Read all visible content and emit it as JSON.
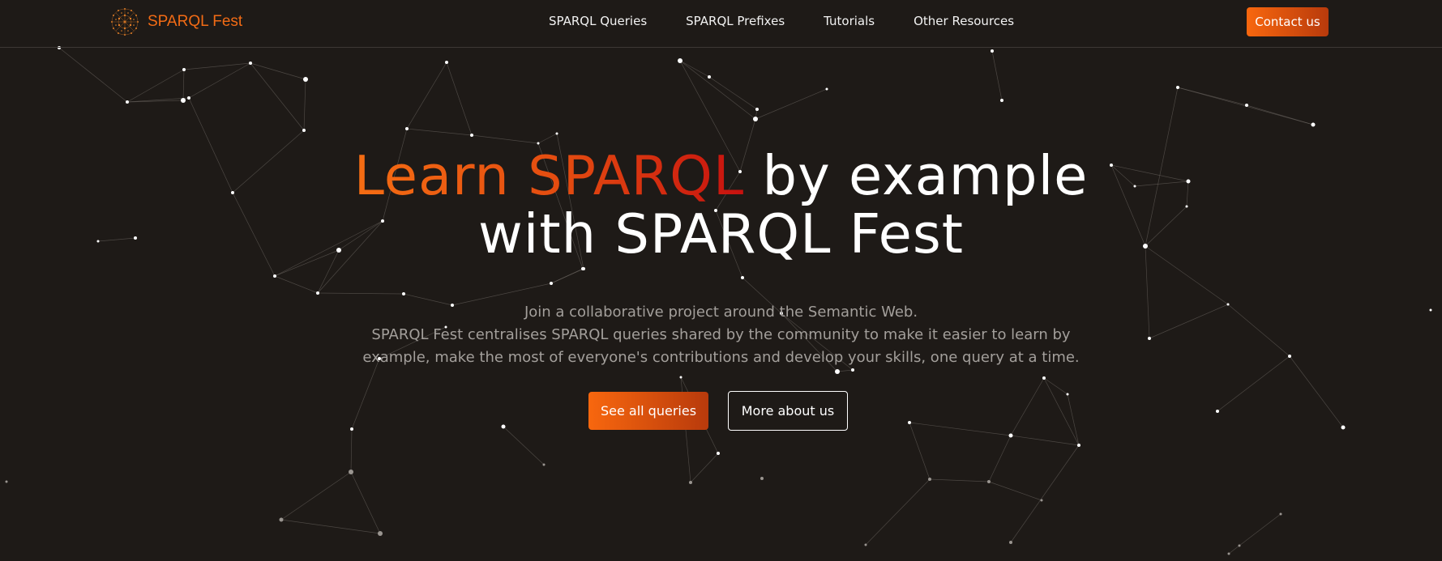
{
  "nav": {
    "brand": "SPARQL Fest",
    "brand_icon": "sparql-fest-sphere-logo",
    "links": [
      "SPARQL Queries",
      "SPARQL Prefixes",
      "Tutorials",
      "Other Resources"
    ],
    "contact": "Contact us"
  },
  "hero": {
    "title_accent": "Learn SPARQL",
    "title_rest_1": " by example",
    "title_line_2": "with SPARQL Fest",
    "subtitle_line_1": "Join a collaborative project around the Semantic Web.",
    "subtitle_line_2": "SPARQL Fest centralises SPARQL queries shared by the community to make it easier to learn by",
    "subtitle_line_3": "example, make the most of everyone's contributions and develop your skills, one query at a time.",
    "primary_button": "See all queries",
    "secondary_button": "More about us"
  },
  "colors": {
    "background": "#1e1a17",
    "accent": "#f26b15",
    "accent_dark": "#b83a0c",
    "accent_red": "#c6110f"
  },
  "background_icon": "particle-network-graph"
}
